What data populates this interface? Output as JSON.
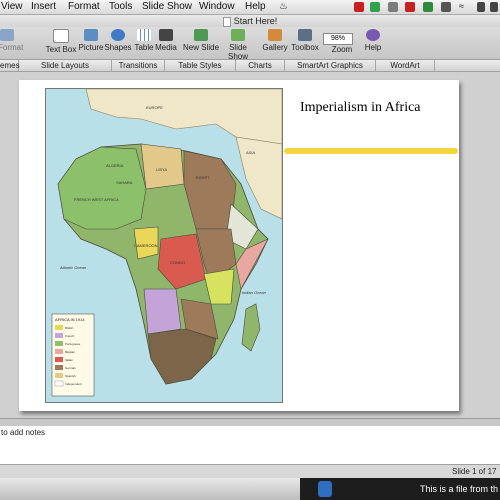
{
  "menubar": {
    "items": [
      "View",
      "Insert",
      "Format",
      "Tools",
      "Slide Show",
      "Window",
      "Help"
    ]
  },
  "window": {
    "title": "Start Here!"
  },
  "toolbar": {
    "buttons": [
      "Format",
      "Text Box",
      "Picture",
      "Shapes",
      "Table",
      "Media",
      "New Slide",
      "Slide Show",
      "Gallery",
      "Toolbox",
      "Zoom",
      "Help"
    ],
    "zoom_value": "98%"
  },
  "ribbon": {
    "tabs": [
      "emes",
      "Slide Layouts",
      "Transitions",
      "Table Styles",
      "Charts",
      "SmartArt Graphics",
      "WordArt"
    ]
  },
  "slide": {
    "title": "Imperialism in Africa",
    "map": {
      "labels": [
        "EUROPE",
        "ASIA",
        "LIBYA",
        "EGYPT",
        "ALGERIA",
        "SAHARA",
        "FRENCH WEST AFRICA",
        "CAMEROON",
        "CONGO",
        "Atlantic Ocean",
        "Indian Ocean"
      ],
      "legend_title": "AFRICA IN 1914",
      "legend_items": [
        "British",
        "French",
        "Portuguese",
        "Belgian",
        "Italian",
        "German",
        "Spanish",
        "Independent"
      ]
    }
  },
  "notes": {
    "placeholder": "to add notes"
  },
  "status": {
    "slide_counter": "Slide 1 of 17"
  },
  "caption": {
    "text": "This is a file from th"
  },
  "colors": {
    "british": "#9c7a5a",
    "french": "#8cc06a",
    "portuguese": "#c4a3d8",
    "belgian": "#e9d75a",
    "italian": "#e8a7a0",
    "german": "#d95a4e",
    "spanish": "#e2c98a",
    "independent": "#8fb66a",
    "highlight": "#f3d02a"
  }
}
